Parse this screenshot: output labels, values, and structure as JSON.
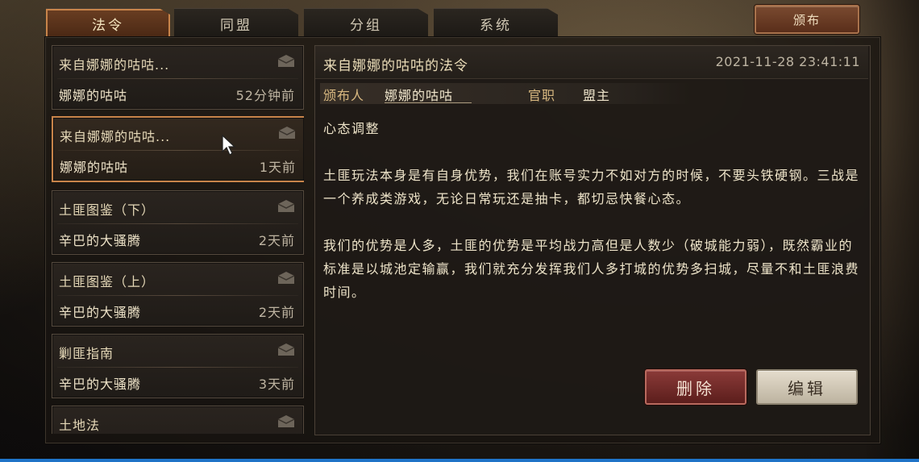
{
  "tabs": [
    {
      "label": "法令",
      "active": true
    },
    {
      "label": "同盟",
      "active": false
    },
    {
      "label": "分组",
      "active": false
    },
    {
      "label": "系统",
      "active": false
    }
  ],
  "publish_label": "颁布",
  "mail_list": [
    {
      "title": "来自娜娜的咕咕...",
      "sender": "娜娜的咕咕",
      "time": "52分钟前",
      "icon": "envelope-icon",
      "selected": false
    },
    {
      "title": "来自娜娜的咕咕...",
      "sender": "娜娜的咕咕",
      "time": "1天前",
      "icon": "envelope-icon",
      "selected": true
    },
    {
      "title": "土匪图鉴（下）",
      "sender": "辛巴的大骚腾",
      "time": "2天前",
      "icon": "envelope-icon",
      "selected": false
    },
    {
      "title": "土匪图鉴（上）",
      "sender": "辛巴的大骚腾",
      "time": "2天前",
      "icon": "envelope-icon",
      "selected": false
    },
    {
      "title": "剿匪指南",
      "sender": "辛巴的大骚腾",
      "time": "3天前",
      "icon": "envelope-icon",
      "selected": false
    },
    {
      "title": "土地法",
      "sender": "",
      "time": "",
      "icon": "envelope-icon",
      "selected": false
    }
  ],
  "detail": {
    "title": "来自娜娜的咕咕的法令",
    "date": "2021-11-28 23:41:11",
    "publisher_label": "颁布人",
    "publisher": "娜娜的咕咕",
    "position_label": "官职",
    "position": "盟主",
    "body": [
      "心态调整",
      "",
      "土匪玩法本身是有自身优势，我们在账号实力不如对方的时候，不要头铁硬钢。三战是一个养成类游戏，无论日常玩还是抽卡，都切忌快餐心态。",
      "",
      "我们的优势是人多，土匪的优势是平均战力高但是人数少（破城能力弱），既然霸业的标准是以城池定输赢，我们就充分发挥我们人多打城的优势多扫城，尽量不和土匪浪费时间。"
    ],
    "delete_label": "删除",
    "edit_label": "编辑"
  },
  "colors": {
    "accent": "#c8844a",
    "delete": "#8a3a38",
    "edit": "#e4dccc"
  }
}
